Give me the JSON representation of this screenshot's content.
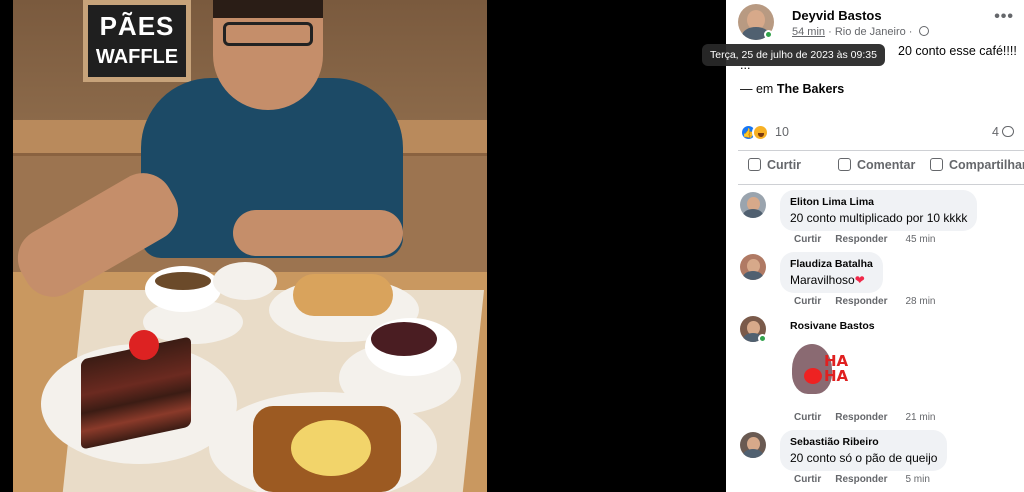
{
  "photo": {
    "sign": {
      "line1": "PÃES",
      "line2": "WAFFLE"
    }
  },
  "post": {
    "author": "Deyvid Bastos",
    "time": "54 min",
    "location_meta": "· Rio de Janeiro ·",
    "text_visible": "20 conto esse café!!!!",
    "ellipsis": "...",
    "tooltip": "Terça, 25 de julho de 2023 às 09:35",
    "location_prefix": "— em",
    "location_name": "The Bakers",
    "reaction_count": "10",
    "comment_count": "4",
    "more_icon": "•••"
  },
  "actions": {
    "like": "Curtir",
    "comment": "Comentar",
    "share": "Compartilhar"
  },
  "comments": [
    {
      "name": "Eliton Lima Lima",
      "text": "20 conto multiplicado por 10 kkkk",
      "like": "Curtir",
      "reply": "Responder",
      "ago": "45 min"
    },
    {
      "name": "Flaudiza Batalha",
      "text": "Maravilhoso",
      "emoji": "❤",
      "like": "Curtir",
      "reply": "Responder",
      "ago": "28 min"
    },
    {
      "name": "Rosivane Bastos",
      "sticker_text": "HA HA",
      "like": "Curtir",
      "reply": "Responder",
      "ago": "21 min"
    },
    {
      "name": "Sebastião Ribeiro",
      "text": "20 conto só o pão de queijo",
      "like": "Curtir",
      "reply": "Responder",
      "ago": "5 min"
    }
  ],
  "colors": {
    "accent": "#1877f2",
    "online": "#31a24c",
    "muted": "#65676b",
    "bubble": "#f0f2f5"
  },
  "icons": [
    "like-reaction-icon",
    "haha-reaction-icon",
    "globe-icon",
    "comment-bubble-icon",
    "thumbs-up-icon",
    "share-icon",
    "more-options-icon"
  ]
}
